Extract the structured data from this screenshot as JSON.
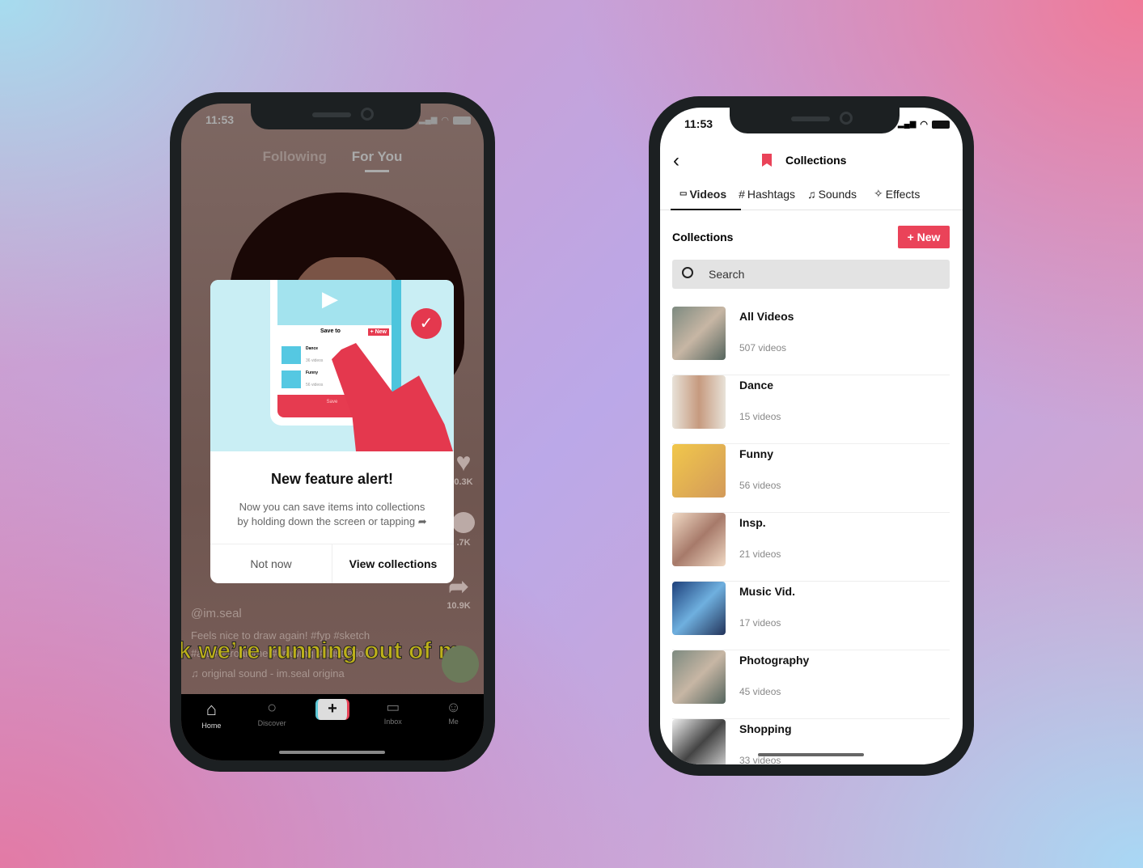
{
  "left_phone": {
    "status": {
      "time": "11:53"
    },
    "feed_tabs": [
      "Following",
      "For You"
    ],
    "modal": {
      "illustration": {
        "header": "Save to",
        "new_label": "+ New",
        "items": [
          {
            "name": "Dance",
            "count": "36 videos"
          },
          {
            "name": "Funny",
            "count": "56 videos"
          }
        ],
        "save_label": "Save"
      },
      "title": "New feature alert!",
      "body_line1": "Now you can save items into collections",
      "body_line2": "by holding down the screen or tapping",
      "not_now": "Not now",
      "view": "View collections"
    },
    "side_counts": {
      "likes": "0.3K",
      "comments": ".7K",
      "shares": "10.9K"
    },
    "username": "@im.seal",
    "caption1": "Feels nice to draw again! #fyp #sketch",
    "caption2": "#art #retroanime #drawing #illustration",
    "sound": "original sound - im.seal   origina",
    "karaoke": "k we’re running out of m",
    "nav": [
      "Home",
      "Discover",
      "",
      "Inbox",
      "Me"
    ]
  },
  "right_phone": {
    "status": {
      "time": "11:53"
    },
    "header": {
      "title": "Collections"
    },
    "tabs": [
      "Videos",
      "Hashtags",
      "Sounds",
      "Effects"
    ],
    "active_tab": "Videos",
    "section_title": "Collections",
    "new_button": "+ New",
    "search_placeholder": "Search",
    "accent": "#ea4359",
    "collections": [
      {
        "name": "All Videos",
        "count": "507 videos"
      },
      {
        "name": "Dance",
        "count": "15 videos"
      },
      {
        "name": "Funny",
        "count": "56 videos"
      },
      {
        "name": "Insp.",
        "count": "21 videos"
      },
      {
        "name": "Music Vid.",
        "count": "17 videos"
      },
      {
        "name": "Photography",
        "count": "45 videos"
      },
      {
        "name": "Shopping",
        "count": "33 videos"
      }
    ]
  }
}
